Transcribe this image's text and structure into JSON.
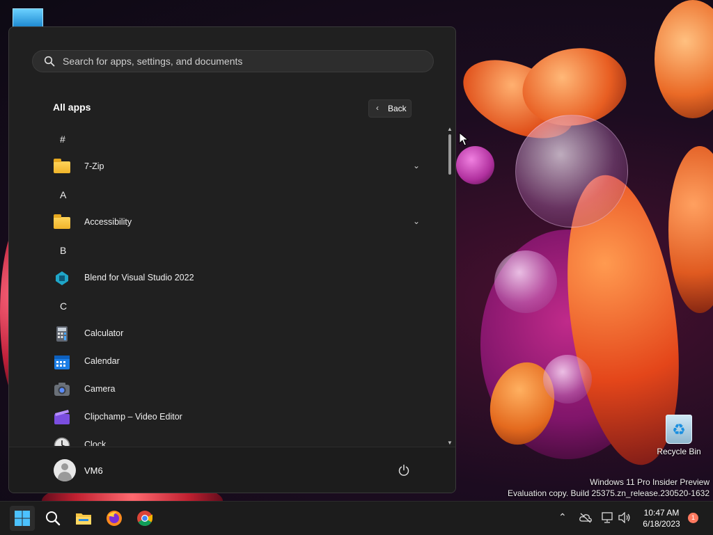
{
  "desktop": {
    "recycle_bin_label": "Recycle Bin",
    "watermark_line1": "Windows 11 Pro Insider Preview",
    "watermark_line2": "Evaluation copy. Build 25375.zn_release.230520-1632"
  },
  "start_menu": {
    "search_placeholder": "Search for apps, settings, and documents",
    "section_title": "All apps",
    "back_label": "Back",
    "groups": [
      {
        "letter": "#"
      },
      {
        "letter": "A"
      },
      {
        "letter": "B"
      },
      {
        "letter": "C"
      }
    ],
    "apps": [
      {
        "name": "7-Zip",
        "icon": "folder-icon",
        "expandable": true
      },
      {
        "name": "Accessibility",
        "icon": "folder-icon",
        "expandable": true
      },
      {
        "name": "Blend for Visual Studio 2022",
        "icon": "blend-icon",
        "expandable": false
      },
      {
        "name": "Calculator",
        "icon": "calculator-icon",
        "expandable": false
      },
      {
        "name": "Calendar",
        "icon": "calendar-icon",
        "expandable": false
      },
      {
        "name": "Camera",
        "icon": "camera-icon",
        "expandable": false
      },
      {
        "name": "Clipchamp – Video Editor",
        "icon": "clipchamp-icon",
        "expandable": false
      },
      {
        "name": "Clock",
        "icon": "clock-icon",
        "expandable": false
      }
    ],
    "user_name": "VM6"
  },
  "taskbar": {
    "time": "10:47 AM",
    "date": "6/18/2023",
    "notification_count": "1",
    "accent": "#4cc2ff"
  }
}
